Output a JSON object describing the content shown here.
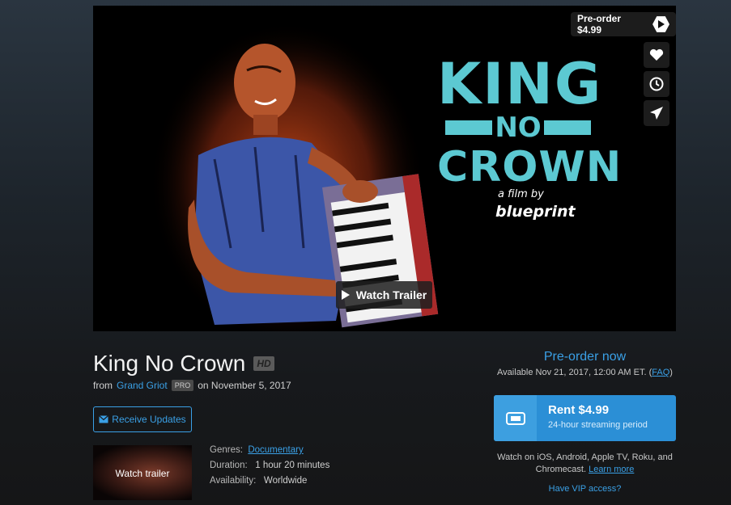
{
  "hero": {
    "poster_title_line1": "KING",
    "poster_title_line2": "NO",
    "poster_title_line3": "CROWN",
    "film_by": "a film by",
    "director_mark": "blueprint",
    "preorder_pill": "Pre-order $4.99",
    "watch_trailer": "Watch Trailer",
    "icons": [
      "play-hexagon-icon",
      "heart-icon",
      "clock-icon",
      "paper-plane-icon",
      "play-icon"
    ]
  },
  "film": {
    "title": "King No Crown",
    "hd_badge": "HD",
    "from_label": "from",
    "creator": "Grand Griot",
    "pro_badge": "PRO",
    "release": "on November 5, 2017",
    "receive_updates": "Receive Updates",
    "thumb_label": "Watch trailer"
  },
  "meta": {
    "genres_label": "Genres:",
    "genres_value": "Documentary",
    "duration_label": "Duration:",
    "duration_value": "1 hour 20 minutes",
    "availability_label": "Availability:",
    "availability_value": "Worldwide"
  },
  "purchase": {
    "preorder_now": "Pre-order now",
    "available_text": "Available Nov 21, 2017, 12:00 AM ET. (",
    "faq": "FAQ",
    "available_close": ")",
    "rent_price": "Rent $4.99",
    "rent_sub": "24-hour streaming period",
    "devices_text": "Watch on iOS, Android, Apple TV, Roku, and Chromecast.",
    "learn_more": "Learn more",
    "vip": "Have VIP access?"
  },
  "colors": {
    "accent": "#3aa0e6",
    "rent_button": "#2b8fd6",
    "poster_teal": "#5cc9d2"
  }
}
